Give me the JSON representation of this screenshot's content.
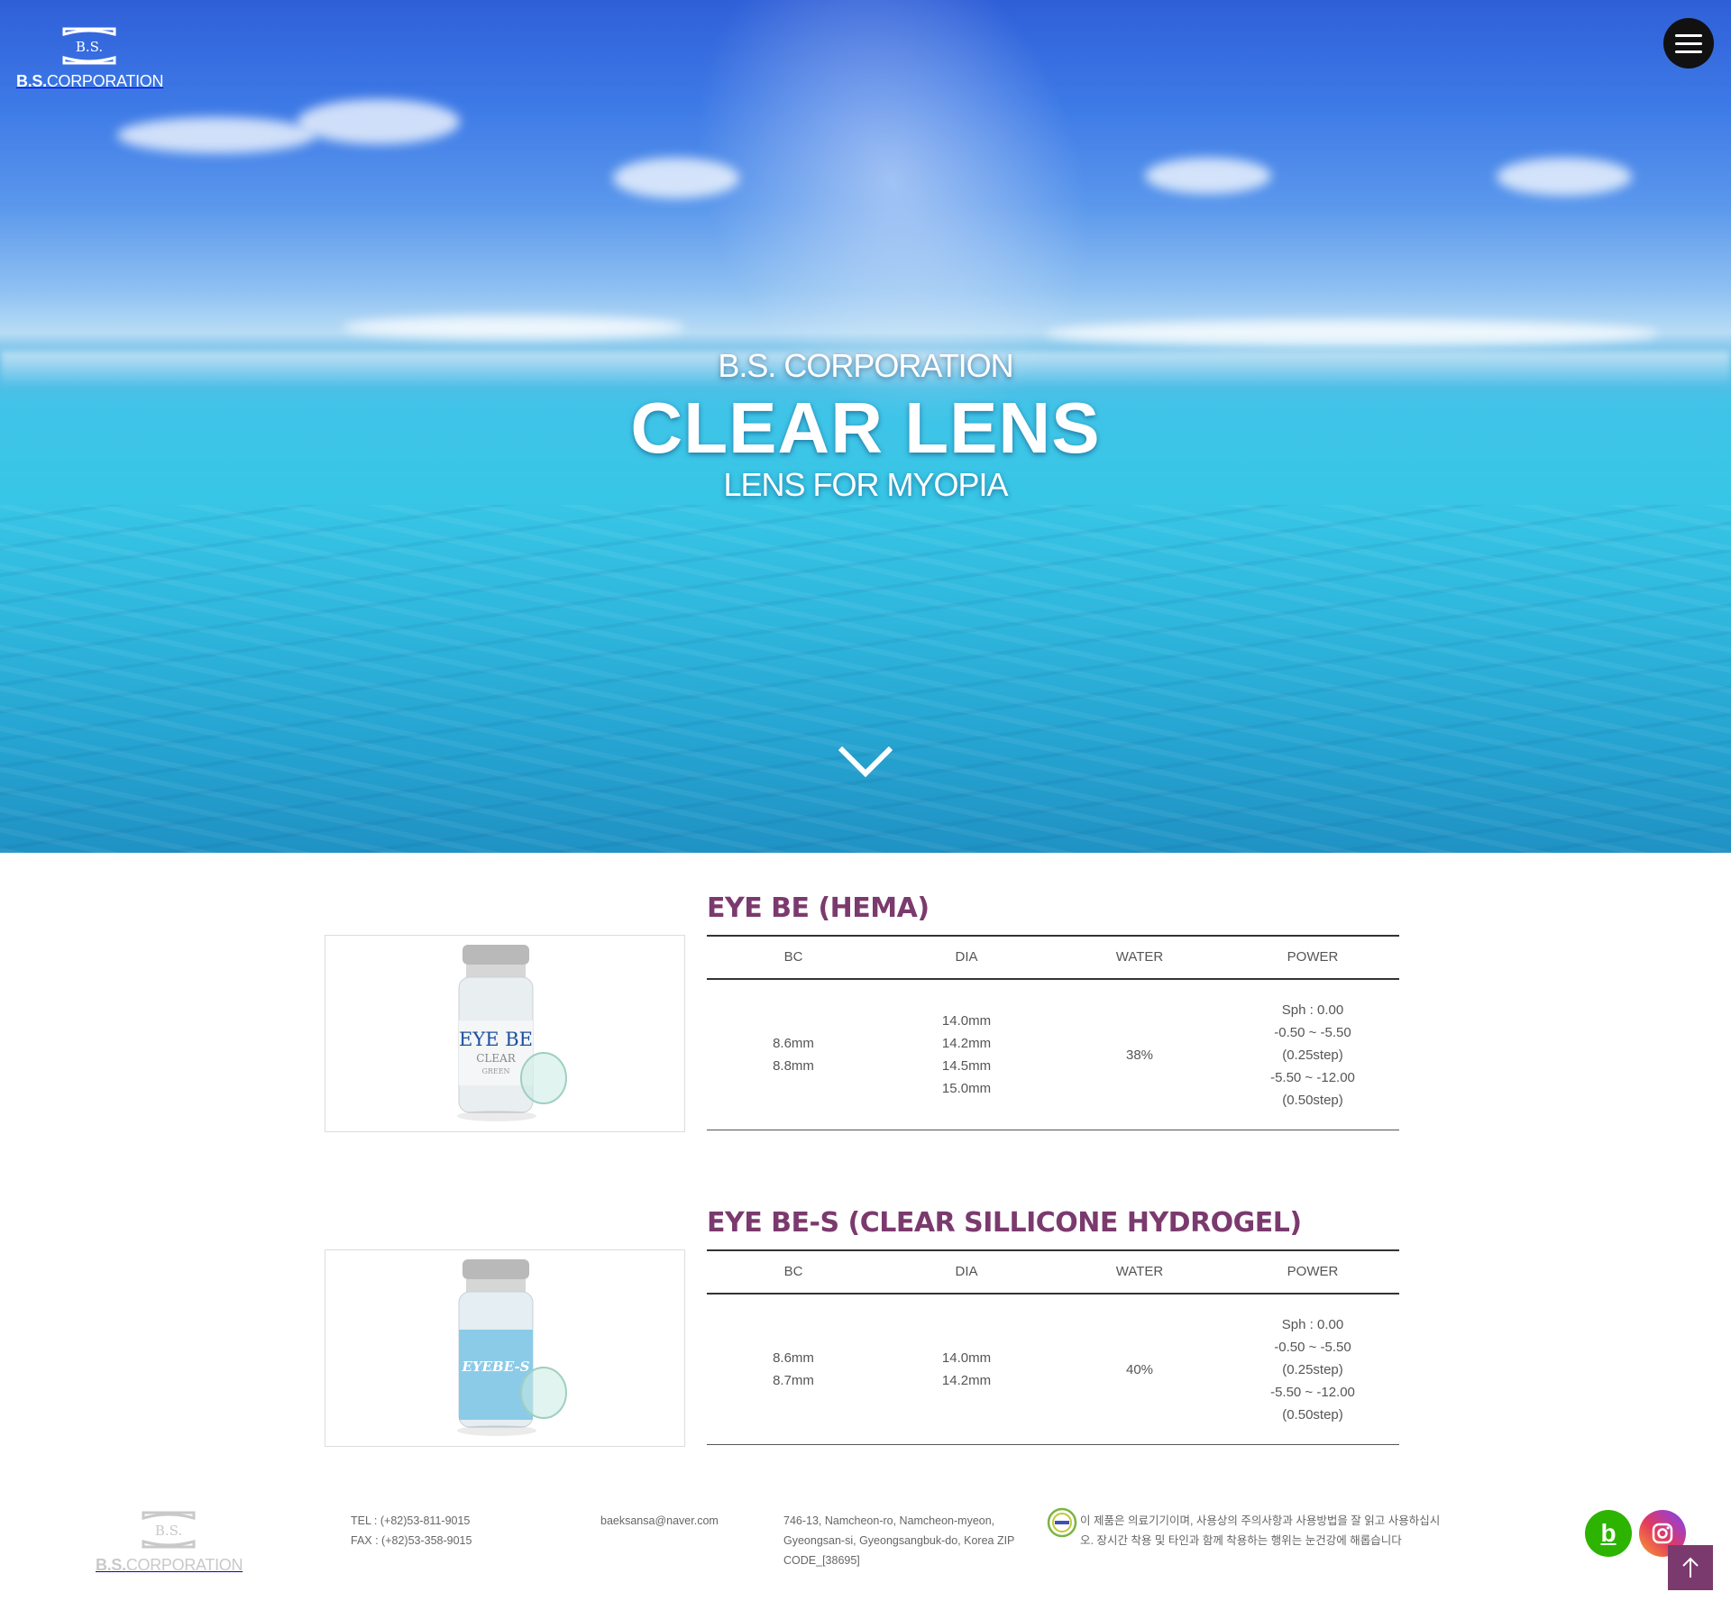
{
  "header": {
    "logo_mark_text": "B.S.",
    "logo_bold": "B.S.",
    "logo_rest": "CORPORATION",
    "menu_icon": "hamburger-icon"
  },
  "hero": {
    "subtitle": "B.S. CORPORATION",
    "title": "CLEAR LENS",
    "tagline": "LENS FOR MYOPIA",
    "scroll_icon": "chevron-down-icon"
  },
  "spec_headers": [
    "BC",
    "DIA",
    "WATER",
    "POWER"
  ],
  "products": [
    {
      "name": "EYE BE (HEMA)",
      "label_brand": "EYE BE",
      "label_line2": "CLEAR",
      "label_line3": "GREEN",
      "bc": [
        "8.6mm",
        "8.8mm"
      ],
      "dia": [
        "14.0mm",
        "14.2mm",
        "14.5mm",
        "15.0mm"
      ],
      "water": "38%",
      "power": [
        "Sph : 0.00",
        "-0.50 ~ -5.50",
        "(0.25step)",
        "-5.50 ~ -12.00",
        "(0.50step)"
      ]
    },
    {
      "name": "EYE BE-S (CLEAR SILLICONE HYDROGEL)",
      "label_brand": "EYEBE-S",
      "bc": [
        "8.6mm",
        "8.7mm"
      ],
      "dia": [
        "14.0mm",
        "14.2mm"
      ],
      "water": "40%",
      "power": [
        "Sph : 0.00",
        "-0.50 ~ -5.50",
        "(0.25step)",
        "-5.50 ~ -12.00",
        "(0.50step)"
      ]
    }
  ],
  "footer": {
    "tel": "TEL : (+82)53-811-9015",
    "fax": "FAX : (+82)53-358-9015",
    "email": "baeksansa@naver.com",
    "address": "746-13, Namcheon-ro, Namcheon-myeon, Gyeongsan-si, Gyeongsangbuk-do, Korea ZIP CODE_[38695]",
    "notice": "이 제품은 의료기기이며, 사용상의 주의사항과 사용방법을 잘 읽고 사용하십시오. 장시간 착용 및 타인과 함께 착용하는 행위는 눈건강에 해롭습니다",
    "blog_letter": "b",
    "colors": {
      "accent": "#7b3a6e",
      "blog": "#2db400"
    }
  }
}
